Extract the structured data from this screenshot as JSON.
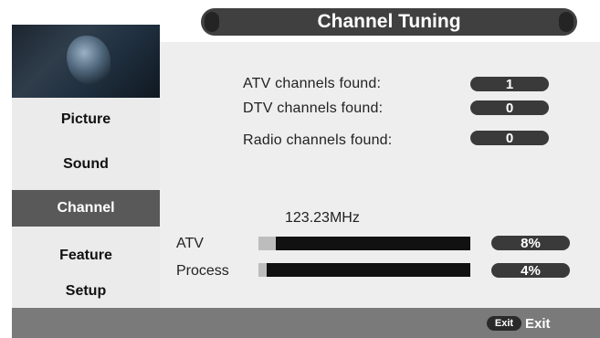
{
  "menu": {
    "items": [
      {
        "label": "Picture"
      },
      {
        "label": "Sound"
      },
      {
        "label": "Channel"
      },
      {
        "label": "Feature"
      },
      {
        "label": "Setup"
      }
    ]
  },
  "header": {
    "title": "Channel Tuning"
  },
  "results": [
    {
      "label": "ATV channels  found:",
      "value": "1"
    },
    {
      "label": "DTV channels  found:",
      "value": "0"
    },
    {
      "label": "Radio channels found:",
      "value": "0"
    }
  ],
  "frequency": "123.23MHz",
  "progress": [
    {
      "label": "ATV",
      "percent_text": "8%",
      "fraction": 0.08
    },
    {
      "label": "Process",
      "percent_text": "4%",
      "fraction": 0.04
    }
  ],
  "footer": {
    "exit_key": "Exit",
    "exit_label": "Exit"
  }
}
